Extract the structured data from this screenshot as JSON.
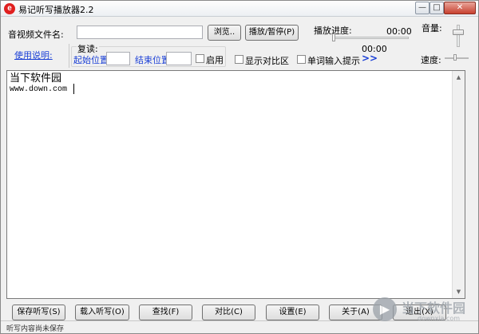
{
  "window": {
    "title": "易记听写播放器2.2",
    "icon_letter": "e",
    "min_glyph": "—",
    "max_glyph": "□",
    "close_glyph": "✕"
  },
  "file": {
    "label": "音视频文件名:",
    "value": "",
    "browse_button": "浏览..",
    "play_pause_button": "播放/暂停(P)"
  },
  "progress": {
    "label": "播放进度:",
    "current_time": "00:00",
    "total_time": "00:00",
    "fraction": 0
  },
  "volume": {
    "label": "音量:",
    "level": 0.7
  },
  "speed": {
    "label": "速度:"
  },
  "help_link": "使用说明:",
  "repeat": {
    "label": "复读:",
    "start_label": "起始位置",
    "start_value": "",
    "end_label": "结束位置",
    "end_value": "",
    "enable_label": "启用"
  },
  "options": {
    "show_diff_label": "显示对比区",
    "word_hint_label": "单词输入提示",
    "expand_glyph": ">>"
  },
  "editor": {
    "lines": [
      "当下软件园",
      "www.down.com"
    ]
  },
  "buttons": {
    "save": "保存听写(S)",
    "load": "载入听写(O)",
    "find": "查找(F)",
    "compare": "对比(C)",
    "settings": "设置(E)",
    "about": "关于(A)",
    "exit": "退出(X)"
  },
  "status": {
    "text": "听写内容尚未保存"
  },
  "watermark": {
    "text": "当下软件园",
    "sub": "downxia.com"
  },
  "colors": {
    "link": "#1a3fd6",
    "close_button": "#c7402f",
    "app_icon": "#e02020"
  }
}
